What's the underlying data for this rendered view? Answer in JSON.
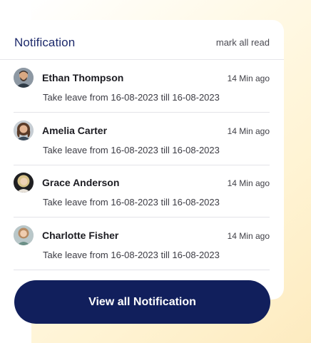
{
  "header": {
    "title": "Notification",
    "mark_all_read": "mark all read"
  },
  "notifications": [
    {
      "name": "Ethan Thompson",
      "time": "14 Min ago",
      "message": "Take leave from 16-08-2023 till 16-08-2023",
      "avatar": "man-beard-avatar"
    },
    {
      "name": "Amelia Carter",
      "time": "14 Min ago",
      "message": "Take leave from 16-08-2023 till 16-08-2023",
      "avatar": "woman-curly-hair-avatar"
    },
    {
      "name": "Grace Anderson",
      "time": "14 Min ago",
      "message": "Take leave from 16-08-2023 till 16-08-2023",
      "avatar": "woman-blonde-avatar"
    },
    {
      "name": "Charlotte Fisher",
      "time": "14 Min ago",
      "message": "Take leave from 16-08-2023 till 16-08-2023",
      "avatar": "woman-light-hair-avatar"
    }
  ],
  "footer": {
    "view_all": "View all Notification"
  },
  "colors": {
    "title": "#1d2a6b",
    "button_bg": "#111f5c",
    "glow": "#fdebc0"
  }
}
